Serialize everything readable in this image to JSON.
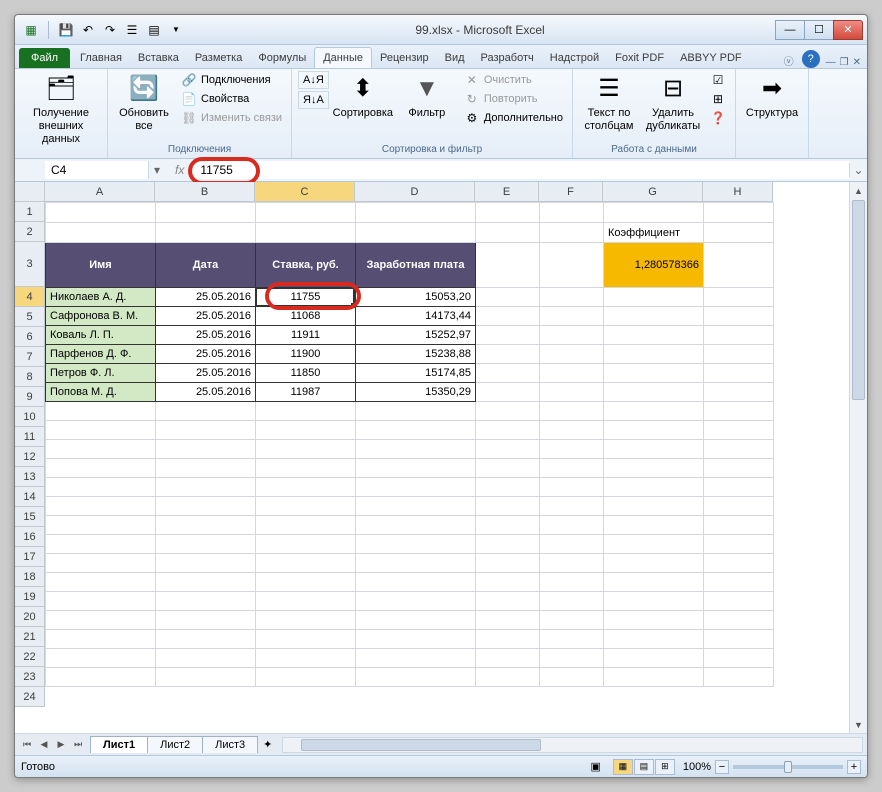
{
  "titlebar": {
    "title": "99.xlsx - Microsoft Excel"
  },
  "ribbon": {
    "file": "Файл",
    "tabs": [
      "Главная",
      "Вставка",
      "Разметка",
      "Формулы",
      "Данные",
      "Рецензир",
      "Вид",
      "Разработч",
      "Надстрой",
      "Foxit PDF",
      "ABBYY PDF"
    ],
    "active_tab": "Данные",
    "groups": {
      "external": {
        "btn": "Получение внешних данных",
        "title": ""
      },
      "connections": {
        "refresh": "Обновить все",
        "conns": "Подключения",
        "props": "Свойства",
        "links": "Изменить связи",
        "title": "Подключения"
      },
      "sort": {
        "az": "А↓Я",
        "za": "Я↓А",
        "sort": "Сортировка",
        "filter": "Фильтр",
        "clear": "Очистить",
        "reapply": "Повторить",
        "advanced": "Дополнительно",
        "title": "Сортировка и фильтр"
      },
      "datatools": {
        "textcol": "Текст по столбцам",
        "dedupe": "Удалить дубликаты",
        "title": "Работа с данными"
      },
      "outline": {
        "label": "Структура"
      }
    }
  },
  "formula_bar": {
    "name": "C4",
    "value": "11755"
  },
  "columns": [
    "A",
    "B",
    "C",
    "D",
    "E",
    "F",
    "G",
    "H"
  ],
  "table": {
    "headers": [
      "Имя",
      "Дата",
      "Ставка, руб.",
      "Заработная плата"
    ],
    "rows": [
      {
        "name": "Николаев А. Д.",
        "date": "25.05.2016",
        "rate": "11755",
        "salary": "15053,20"
      },
      {
        "name": "Сафронова В. М.",
        "date": "25.05.2016",
        "rate": "11068",
        "salary": "14173,44"
      },
      {
        "name": "Коваль Л. П.",
        "date": "25.05.2016",
        "rate": "11911",
        "salary": "15252,97"
      },
      {
        "name": "Парфенов Д. Ф.",
        "date": "25.05.2016",
        "rate": "11900",
        "salary": "15238,88"
      },
      {
        "name": "Петров Ф. Л.",
        "date": "25.05.2016",
        "rate": "11850",
        "salary": "15174,85"
      },
      {
        "name": "Попова М. Д.",
        "date": "25.05.2016",
        "rate": "11987",
        "salary": "15350,29"
      }
    ]
  },
  "coefficient": {
    "label": "Коэффициент",
    "value": "1,280578366"
  },
  "sheets": {
    "items": [
      "Лист1",
      "Лист2",
      "Лист3"
    ],
    "active": 0
  },
  "status": {
    "ready": "Готово",
    "zoom": "100%"
  }
}
